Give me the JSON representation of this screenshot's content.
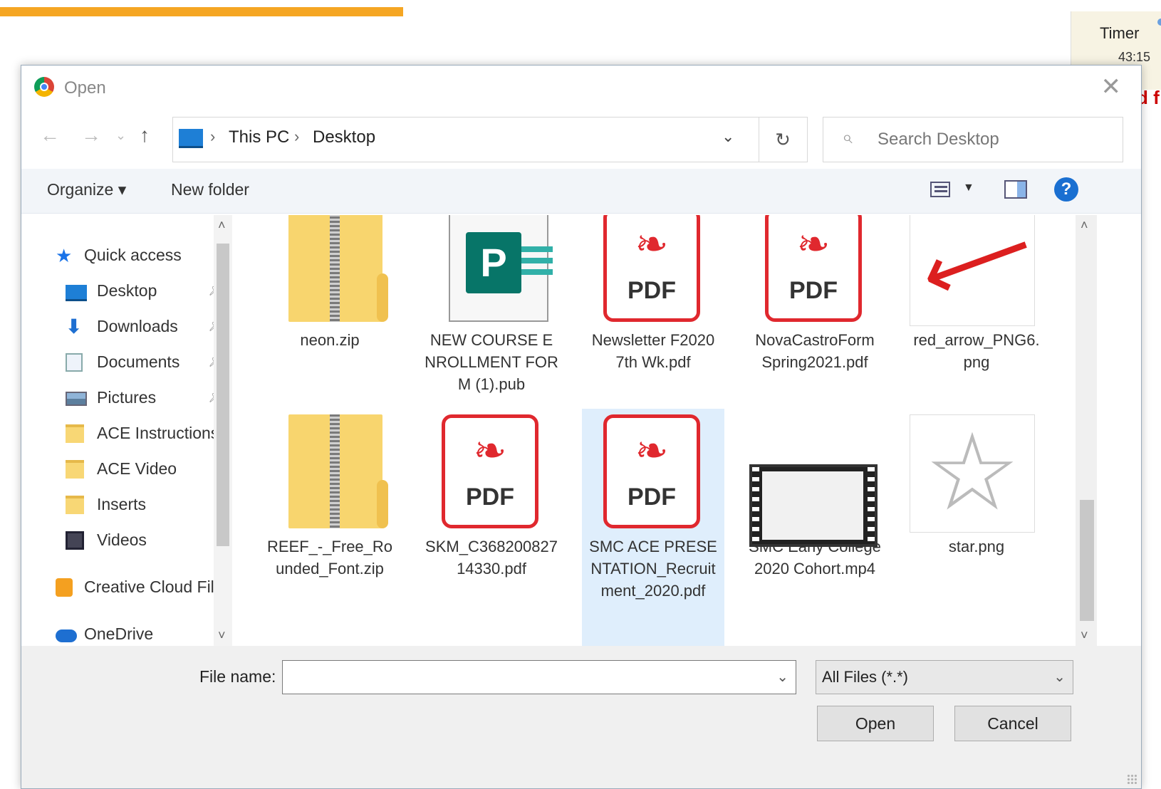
{
  "background": {
    "timer_label": "Timer",
    "timer_value": "43:15",
    "partial_text": "d f"
  },
  "dialog": {
    "title": "Open",
    "icon": "chrome-icon"
  },
  "navigation": {
    "breadcrumb": [
      "This PC",
      "Desktop"
    ],
    "search_placeholder": "Search Desktop"
  },
  "toolbar": {
    "organize_label": "Organize ▾",
    "new_folder_label": "New folder"
  },
  "sidebar": {
    "items": [
      {
        "label": "Quick access",
        "icon": "star-icon",
        "pinned": false
      },
      {
        "label": "Desktop",
        "icon": "desktop-icon",
        "pinned": true
      },
      {
        "label": "Downloads",
        "icon": "download-icon",
        "pinned": true
      },
      {
        "label": "Documents",
        "icon": "documents-icon",
        "pinned": true
      },
      {
        "label": "Pictures",
        "icon": "pictures-icon",
        "pinned": true
      },
      {
        "label": "ACE Instructions",
        "icon": "folder-icon",
        "pinned": false
      },
      {
        "label": "ACE Video",
        "icon": "folder-icon",
        "pinned": false
      },
      {
        "label": "Inserts",
        "icon": "folder-icon",
        "pinned": false
      },
      {
        "label": "Videos",
        "icon": "videos-icon",
        "pinned": false
      },
      {
        "label": "Creative Cloud Fil",
        "icon": "creative-cloud-icon",
        "pinned": false
      },
      {
        "label": "OneDrive",
        "icon": "onedrive-icon",
        "pinned": false
      }
    ]
  },
  "files": [
    {
      "name": "neon.zip",
      "type": "zip"
    },
    {
      "name": "NEW  COURSE ENROLLMENT FORM (1).pub",
      "type": "pub"
    },
    {
      "name": "Newsletter F2020 7th Wk.pdf",
      "type": "pdf"
    },
    {
      "name": "NovaCastroForm Spring2021.pdf",
      "type": "pdf"
    },
    {
      "name": "red_arrow_PNG6.png",
      "type": "image-arrow"
    },
    {
      "name": "REEF_-_Free_Rounded_Font.zip",
      "type": "zip"
    },
    {
      "name": "SKM_C36820082714330.pdf",
      "type": "pdf"
    },
    {
      "name": "SMC ACE PRESENTATION_Recruitment_2020.pdf",
      "type": "pdf",
      "selected": true
    },
    {
      "name": "SMC Early College 2020 Cohort.mp4",
      "type": "video"
    },
    {
      "name": "star.png",
      "type": "image-star"
    }
  ],
  "pdf_label": "PDF",
  "pub_badge": "P",
  "bottom": {
    "file_name_label": "File name:",
    "file_name_value": "",
    "filter_value": "All Files (*.*)",
    "open_label": "Open",
    "cancel_label": "Cancel"
  },
  "colors": {
    "accent": "#1a6fd1",
    "pdf_red": "#e0282e",
    "selection": "#dfeefc",
    "orange_bar": "#f5a623"
  }
}
